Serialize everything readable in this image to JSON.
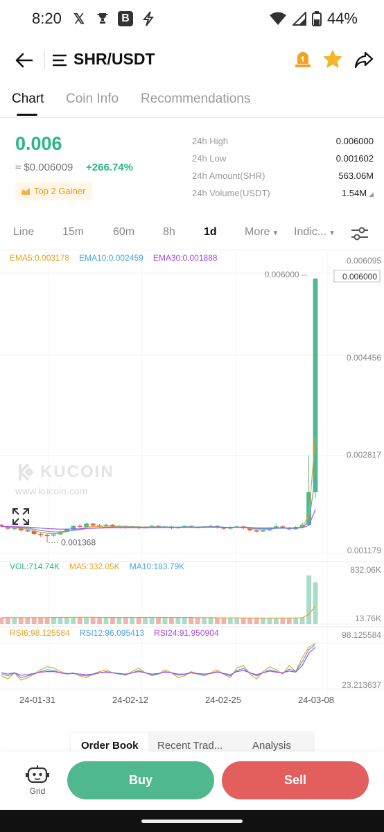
{
  "status_bar": {
    "time": "8:20",
    "icons": [
      "x-icon",
      "trophy-icon",
      "b-icon",
      "bolt-icon"
    ],
    "battery": "44%"
  },
  "header": {
    "pair": "SHR/USDT"
  },
  "tabs": [
    {
      "label": "Chart",
      "active": true
    },
    {
      "label": "Coin Info",
      "active": false
    },
    {
      "label": "Recommendations",
      "active": false
    }
  ],
  "ticker": {
    "price": "0.006",
    "fiat": "≈ $0.006009",
    "change": "+266.74%",
    "badge": "Top 2 Gainer",
    "stats": [
      {
        "label": "24h High",
        "value": "0.006000"
      },
      {
        "label": "24h Low",
        "value": "0.001602"
      },
      {
        "label": "24h Amount(SHR)",
        "value": "563.06M"
      },
      {
        "label": "24h Volume(USDT)",
        "value": "1.54M"
      }
    ]
  },
  "intervals": [
    {
      "label": "Line",
      "active": false
    },
    {
      "label": "15m",
      "active": false
    },
    {
      "label": "60m",
      "active": false
    },
    {
      "label": "8h",
      "active": false
    },
    {
      "label": "1d",
      "active": true
    },
    {
      "label": "More",
      "active": false
    },
    {
      "label": "Indic...",
      "active": false
    }
  ],
  "legends": {
    "ema5": "EMA5:0.003178",
    "ema10": "EMA10:0.002459",
    "ema30": "EMA30:0.001888",
    "vol": "VOL:714.74K",
    "ma5": "MA5:332.05K",
    "ma10": "MA10:183.79K",
    "rsi6": "RSI6:98.125584",
    "rsi12": "RSI12:96.095413",
    "rsi24": "RSI24:91.950904"
  },
  "watermark": {
    "brand": "KUCOIN",
    "url": "www.kucoin.com"
  },
  "colors": {
    "up": "#4fb88e",
    "down": "#e35f5d",
    "ema5": "#e8a326",
    "ema10": "#4aa5e0",
    "ema30": "#a94ee0"
  },
  "chart_data": {
    "type": "candlestick",
    "price_axis": [
      "0.006095",
      "0.004456",
      "0.002817",
      "0.001179"
    ],
    "high_marker": "0.006000",
    "current_price_tag": "0.006000",
    "low_marker": "0.001368",
    "volume_axis": [
      "832.06K",
      "13.76K"
    ],
    "rsi_axis": [
      "98.125584",
      "23.213637"
    ],
    "x_ticks": [
      "24-01-31",
      "24-02-12",
      "24-02-25",
      "24-03-08"
    ],
    "ylim": [
      0.001179,
      0.006095
    ],
    "candles": [
      [
        0.00168,
        0.00165,
        0.0017,
        0.00163
      ],
      [
        0.00165,
        0.00161,
        0.00166,
        0.00159
      ],
      [
        0.00161,
        0.00162,
        0.00164,
        0.00158
      ],
      [
        0.00162,
        0.00158,
        0.00163,
        0.00156
      ],
      [
        0.00158,
        0.00157,
        0.0016,
        0.00155
      ],
      [
        0.00157,
        0.00152,
        0.00158,
        0.0015
      ],
      [
        0.00152,
        0.0015,
        0.00154,
        0.00147
      ],
      [
        0.0015,
        0.00149,
        0.00152,
        0.00137
      ],
      [
        0.00149,
        0.00151,
        0.00153,
        0.00146
      ],
      [
        0.00151,
        0.00156,
        0.00158,
        0.0015
      ],
      [
        0.00156,
        0.0016,
        0.00162,
        0.00155
      ],
      [
        0.0016,
        0.00166,
        0.00168,
        0.00159
      ],
      [
        0.00166,
        0.00164,
        0.00169,
        0.00162
      ],
      [
        0.00164,
        0.0017,
        0.00172,
        0.00163
      ],
      [
        0.0017,
        0.00167,
        0.00171,
        0.00165
      ],
      [
        0.00167,
        0.00165,
        0.00169,
        0.00163
      ],
      [
        0.00165,
        0.00168,
        0.0017,
        0.00164
      ],
      [
        0.00168,
        0.00164,
        0.00169,
        0.00162
      ],
      [
        0.00164,
        0.00166,
        0.00168,
        0.00163
      ],
      [
        0.00166,
        0.00163,
        0.00167,
        0.00161
      ],
      [
        0.00163,
        0.00165,
        0.00167,
        0.00162
      ],
      [
        0.00165,
        0.00162,
        0.00166,
        0.0016
      ],
      [
        0.00162,
        0.00164,
        0.00166,
        0.00161
      ],
      [
        0.00164,
        0.00166,
        0.00168,
        0.00163
      ],
      [
        0.00166,
        0.00163,
        0.00167,
        0.00162
      ],
      [
        0.00163,
        0.00165,
        0.00166,
        0.00162
      ],
      [
        0.00165,
        0.00162,
        0.00166,
        0.0016
      ],
      [
        0.00162,
        0.00164,
        0.00165,
        0.00161
      ],
      [
        0.00164,
        0.00166,
        0.00167,
        0.00163
      ],
      [
        0.00166,
        0.00164,
        0.00167,
        0.00162
      ],
      [
        0.00164,
        0.00163,
        0.00165,
        0.00162
      ],
      [
        0.00163,
        0.00165,
        0.00166,
        0.00162
      ],
      [
        0.00165,
        0.00166,
        0.00168,
        0.00163
      ],
      [
        0.00166,
        0.00163,
        0.00167,
        0.00161
      ],
      [
        0.00163,
        0.00161,
        0.00164,
        0.00159
      ],
      [
        0.00161,
        0.00163,
        0.00165,
        0.0016
      ],
      [
        0.00163,
        0.00165,
        0.00167,
        0.00162
      ],
      [
        0.00165,
        0.00162,
        0.00166,
        0.0016
      ],
      [
        0.00162,
        0.00158,
        0.00163,
        0.00156
      ],
      [
        0.00158,
        0.00156,
        0.00159,
        0.00154
      ],
      [
        0.00156,
        0.00158,
        0.0016,
        0.00155
      ],
      [
        0.00158,
        0.00162,
        0.00164,
        0.00157
      ],
      [
        0.00162,
        0.00165,
        0.0017,
        0.00161
      ],
      [
        0.00165,
        0.00163,
        0.00167,
        0.00161
      ],
      [
        0.00163,
        0.0016,
        0.00164,
        0.00158
      ],
      [
        0.0016,
        0.00164,
        0.00166,
        0.00159
      ],
      [
        0.00164,
        0.00168,
        0.00172,
        0.00162
      ],
      [
        0.00168,
        0.00225,
        0.0029,
        0.00166
      ],
      [
        0.00225,
        0.006,
        0.006,
        0.00215
      ]
    ],
    "volume": [
      0.1,
      0.12,
      0.09,
      0.1,
      0.11,
      0.12,
      0.1,
      0.11,
      0.12,
      0.13,
      0.12,
      0.13,
      0.12,
      0.11,
      0.12,
      0.11,
      0.12,
      0.11,
      0.1,
      0.12,
      0.11,
      0.12,
      0.11,
      0.12,
      0.11,
      0.12,
      0.11,
      0.12,
      0.11,
      0.1,
      0.09,
      0.11,
      0.1,
      0.09,
      0.08,
      0.09,
      0.1,
      0.09,
      0.08,
      0.07,
      0.08,
      0.09,
      0.1,
      0.09,
      0.08,
      0.1,
      0.12,
      832.06,
      714.74
    ],
    "rsi6": [
      45,
      40,
      50,
      38,
      42,
      48,
      55,
      60,
      58,
      52,
      48,
      50,
      45,
      42,
      48,
      52,
      55,
      50,
      48,
      46,
      52,
      58,
      50,
      45,
      48,
      55,
      50,
      42,
      45,
      52,
      48,
      45,
      50,
      55,
      48,
      42,
      58,
      62,
      48,
      40,
      52,
      60,
      55,
      48,
      62,
      52,
      75,
      92,
      98.13
    ],
    "rsi12": [
      48,
      45,
      50,
      42,
      45,
      48,
      52,
      55,
      54,
      50,
      48,
      49,
      46,
      45,
      47,
      50,
      52,
      50,
      48,
      47,
      50,
      54,
      50,
      47,
      48,
      52,
      50,
      46,
      47,
      50,
      48,
      47,
      49,
      52,
      48,
      45,
      54,
      57,
      50,
      45,
      50,
      55,
      52,
      49,
      56,
      52,
      68,
      88,
      96.1
    ],
    "rsi24": [
      50,
      48,
      50,
      46,
      47,
      49,
      51,
      52,
      52,
      50,
      49,
      49,
      48,
      47,
      48,
      50,
      51,
      50,
      49,
      48,
      50,
      52,
      50,
      48,
      49,
      51,
      50,
      48,
      48,
      50,
      49,
      48,
      49,
      51,
      49,
      47,
      52,
      54,
      50,
      47,
      50,
      53,
      51,
      50,
      53,
      51,
      62,
      82,
      91.95
    ]
  },
  "order_tabs": [
    {
      "label": "Order Book",
      "active": true
    },
    {
      "label": "Recent Trad...",
      "active": false
    },
    {
      "label": "Analysis",
      "active": false
    }
  ],
  "actions": {
    "grid": "Grid",
    "buy": "Buy",
    "sell": "Sell"
  }
}
